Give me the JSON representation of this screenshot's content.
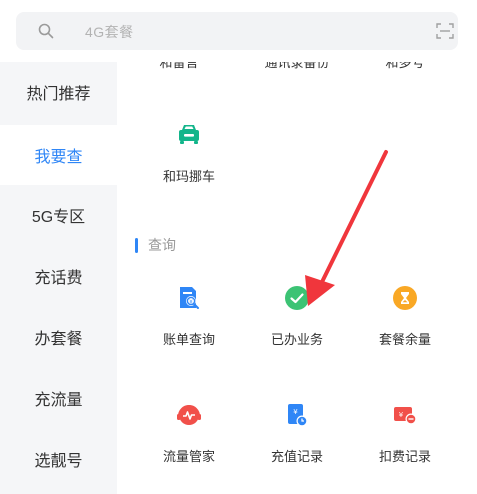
{
  "search": {
    "placeholder": "4G套餐"
  },
  "sidebar": {
    "items": [
      {
        "label": "热门推荐",
        "active": false
      },
      {
        "label": "我要查",
        "active": true
      },
      {
        "label": "5G专区",
        "active": false
      },
      {
        "label": "充话费",
        "active": false
      },
      {
        "label": "办套餐",
        "active": false
      },
      {
        "label": "充流量",
        "active": false
      },
      {
        "label": "选靓号",
        "active": false
      }
    ]
  },
  "content": {
    "clipped_row": [
      "和留言",
      "通讯录备份",
      "和多号"
    ],
    "top_service": {
      "label": "和玛挪车",
      "icon": "car-icon"
    },
    "query_section": {
      "title": "查询",
      "items": [
        {
          "label": "账单查询",
          "icon": "bill-query-icon"
        },
        {
          "label": "已办业务",
          "icon": "check-circle-icon"
        },
        {
          "label": "套餐余量",
          "icon": "hourglass-icon"
        },
        {
          "label": "流量管家",
          "icon": "traffic-manager-icon"
        },
        {
          "label": "充值记录",
          "icon": "recharge-record-icon"
        },
        {
          "label": "扣费记录",
          "icon": "deduction-record-icon"
        }
      ]
    }
  },
  "colors": {
    "accent": "#2f86f6",
    "annotation": "#f0363c",
    "green": "#3cc374",
    "teal": "#13b58b",
    "orange": "#f9a825",
    "red": "#f1504a"
  }
}
